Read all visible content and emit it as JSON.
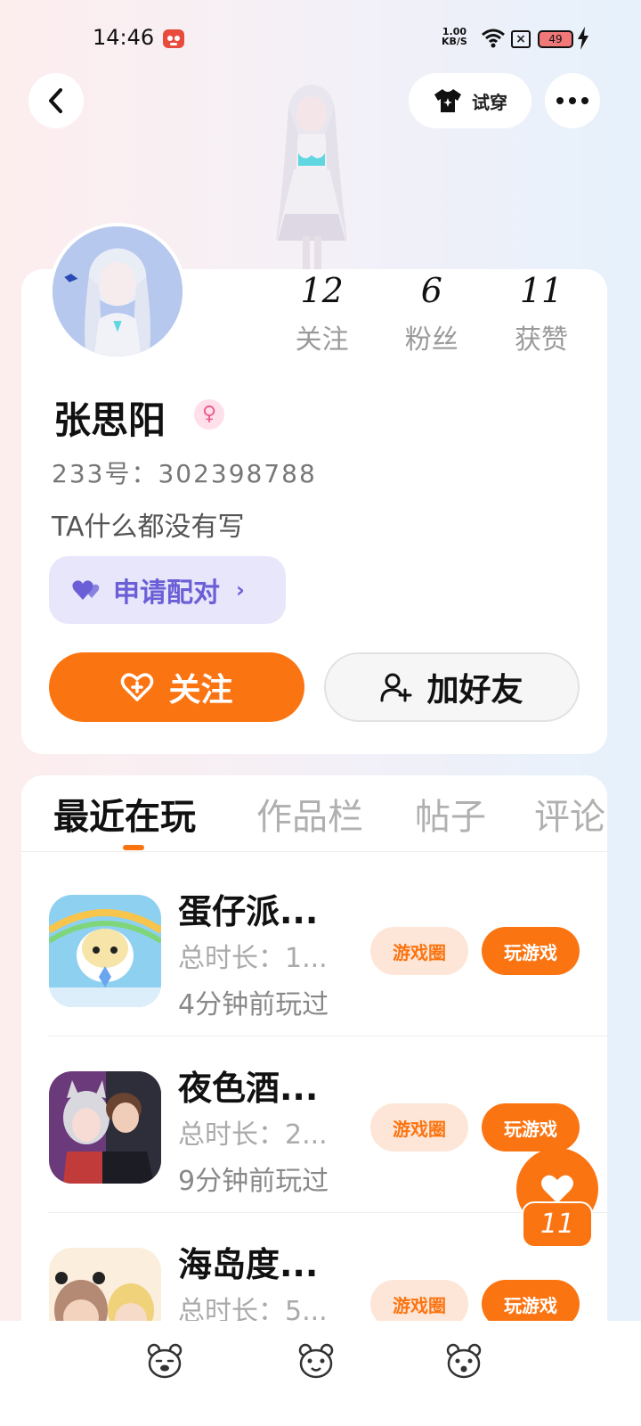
{
  "status": {
    "time": "14:46",
    "speed_value": "1.00",
    "speed_unit": "KB/S",
    "battery": "49"
  },
  "header": {
    "tryon_label": "试穿"
  },
  "profile": {
    "stats": [
      {
        "value": "12",
        "label": "关注"
      },
      {
        "value": "6",
        "label": "粉丝"
      },
      {
        "value": "11",
        "label": "获赞"
      }
    ],
    "username": "张思阳",
    "gender_symbol": "♀",
    "uid": "233号：302398788",
    "bio": "TA什么都没有写",
    "match_label": "申请配对",
    "follow_label": "关注",
    "add_friend_label": "加好友"
  },
  "tabs": [
    {
      "label": "最近在玩"
    },
    {
      "label": "作品栏"
    },
    {
      "label": "帖子"
    },
    {
      "label": "评论"
    }
  ],
  "games": [
    {
      "name": "蛋仔派...",
      "duration": "总时长：1...",
      "last_played": "4分钟前玩过",
      "circle_label": "游戏圈",
      "play_label": "玩游戏"
    },
    {
      "name": "夜色酒...",
      "duration": "总时长：2...",
      "last_played": "9分钟前玩过",
      "circle_label": "游戏圈",
      "play_label": "玩游戏"
    },
    {
      "name": "海岛度...",
      "duration": "总时长：5...",
      "last_played": "",
      "circle_label": "游戏圈",
      "play_label": "玩游戏"
    }
  ],
  "floating": {
    "like_count": "11"
  },
  "colors": {
    "accent": "#fb7412",
    "match": "#6a5fd6"
  }
}
